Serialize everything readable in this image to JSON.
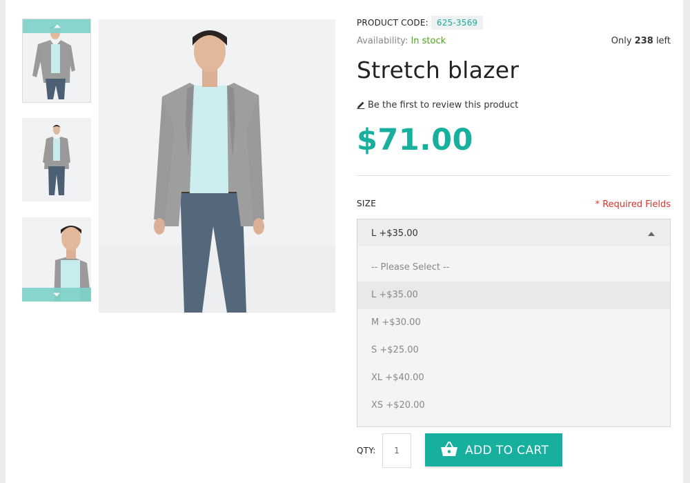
{
  "product": {
    "code_label": "PRODUCT CODE:",
    "code": "625-3569",
    "availability_label": "Availability:",
    "availability": "In stock",
    "stock_prefix": "Only",
    "stock_count": "238",
    "stock_suffix": "left",
    "title": "Stretch blazer",
    "review_link": "Be the first to review this product",
    "price": "$71.00"
  },
  "options": {
    "size_label": "SIZE",
    "required_note": "* Required Fields",
    "selected": "L +$35.00",
    "items": [
      {
        "label": "-- Please Select --"
      },
      {
        "label": "L +$35.00"
      },
      {
        "label": "M +$30.00"
      },
      {
        "label": "S +$25.00"
      },
      {
        "label": "XL +$40.00"
      },
      {
        "label": "XS +$20.00"
      }
    ]
  },
  "cart": {
    "qty_label": "QTY:",
    "qty_value": "1",
    "add_label": "ADD TO CART"
  },
  "colors": {
    "accent": "#17b09f",
    "in_stock": "#4aa517",
    "required": "#d9342b"
  },
  "icons": {
    "thumb_up": "chevron-up-icon",
    "thumb_down": "chevron-down-icon",
    "review": "pencil-icon",
    "dropdown": "caret-up-icon",
    "cart": "basket-icon"
  }
}
